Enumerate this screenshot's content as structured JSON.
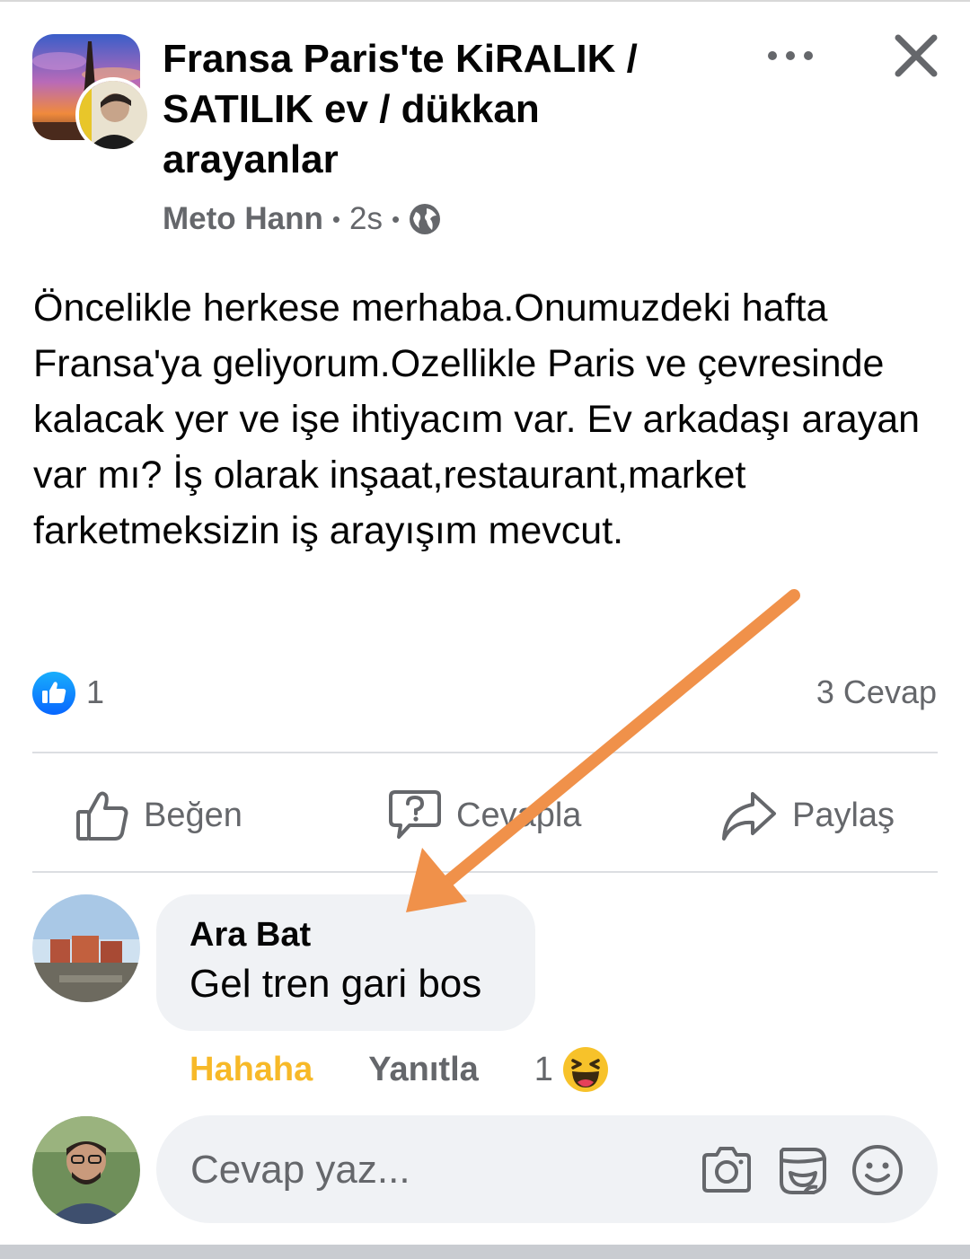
{
  "post": {
    "group_name": "Fransa Paris'te KiRALIK / SATILIK ev / dükkan arayanlar",
    "author": "Meto Hann",
    "time": "2s",
    "separator": "•",
    "privacy_icon": "globe-icon",
    "text": "Öncelikle herkese merhaba.Onumuzdeki hafta Fransa'ya geliyorum.Ozellikle Paris ve çevresinde kalacak yer ve işe ihtiyacım var. Ev arkadaşı arayan var mı? İş olarak inşaat,restaurant,market farketmeksizin iş arayışım mevcut.",
    "like_count": "1",
    "reply_count": "3 Cevap"
  },
  "actions": {
    "like": "Beğen",
    "reply": "Cevapla",
    "share": "Paylaş"
  },
  "comment": {
    "author": "Ara Bat",
    "text": "Gel tren gari bos",
    "reaction_label": "Hahaha",
    "reply_label": "Yanıtla",
    "reaction_count": "1"
  },
  "composer": {
    "placeholder": "Cevap yaz..."
  },
  "colors": {
    "accent_blue": "#1877f2",
    "haha_yellow": "#f7b928",
    "annotation_arrow": "#f0914a",
    "muted_text": "#65676b",
    "bubble_bg": "#f0f2f5"
  }
}
